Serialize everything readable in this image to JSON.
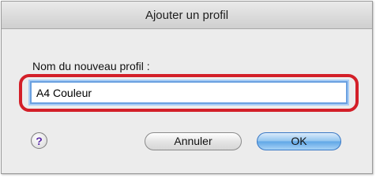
{
  "dialog": {
    "title": "Ajouter un profil",
    "field_label": "Nom du nouveau profil :",
    "field_value": "A4 Couleur",
    "help_label": "?",
    "cancel_label": "Annuler",
    "ok_label": "OK"
  },
  "colors": {
    "highlight": "#d31f28",
    "default_button": "#5fa6e6",
    "focus_ring": "#6aa0e0"
  },
  "icons": {
    "help": "help-icon"
  }
}
